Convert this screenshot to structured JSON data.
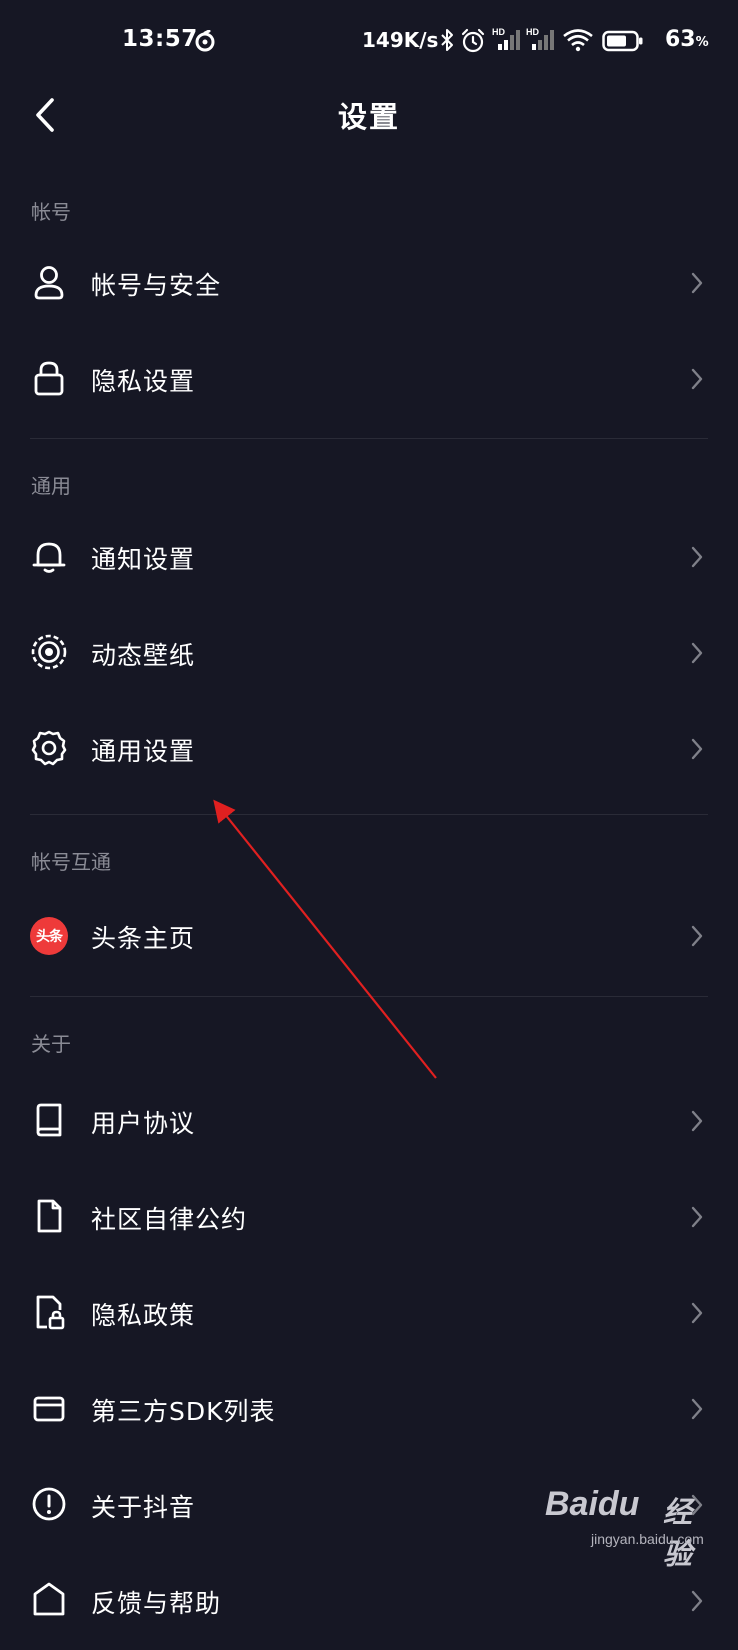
{
  "status_bar": {
    "time": "13:57",
    "net_speed": "149K/s",
    "battery_percent": "63",
    "battery_unit": "%",
    "icons": [
      "netease-music-icon",
      "bluetooth-icon",
      "alarm-icon",
      "signal-hd-icon",
      "signal-hd-icon",
      "wifi-icon",
      "battery-icon"
    ]
  },
  "header": {
    "title": "设置"
  },
  "sections": {
    "account": {
      "label": "帐号",
      "items": [
        {
          "label": "帐号与安全",
          "icon": "user-icon"
        },
        {
          "label": "隐私设置",
          "icon": "lock-icon"
        }
      ]
    },
    "general": {
      "label": "通用",
      "items": [
        {
          "label": "通知设置",
          "icon": "bell-icon"
        },
        {
          "label": "动态壁纸",
          "icon": "live-wallpaper-icon"
        },
        {
          "label": "通用设置",
          "icon": "gear-icon"
        }
      ]
    },
    "linked": {
      "label": "帐号互通",
      "items": [
        {
          "label": "头条主页",
          "icon": "toutiao-icon",
          "badge_text": "头条"
        }
      ]
    },
    "about": {
      "label": "关于",
      "items": [
        {
          "label": "用户协议",
          "icon": "book-icon"
        },
        {
          "label": "社区自律公约",
          "icon": "document-icon"
        },
        {
          "label": "隐私政策",
          "icon": "privacy-document-icon"
        },
        {
          "label": "第三方SDK列表",
          "icon": "wallet-icon"
        },
        {
          "label": "关于抖音",
          "icon": "info-icon"
        },
        {
          "label": "反馈与帮助",
          "icon": "help-icon"
        }
      ]
    }
  },
  "watermark": {
    "brand": "Baidu",
    "text": "经验",
    "domain": "jingyan.baidu.com"
  },
  "colors": {
    "background": "#161724",
    "text": "#ffffff",
    "muted": "#8a8b95",
    "divider": "#2a2b37",
    "annotation_arrow": "#e02020",
    "toutiao_red": "#ee3a3a"
  }
}
